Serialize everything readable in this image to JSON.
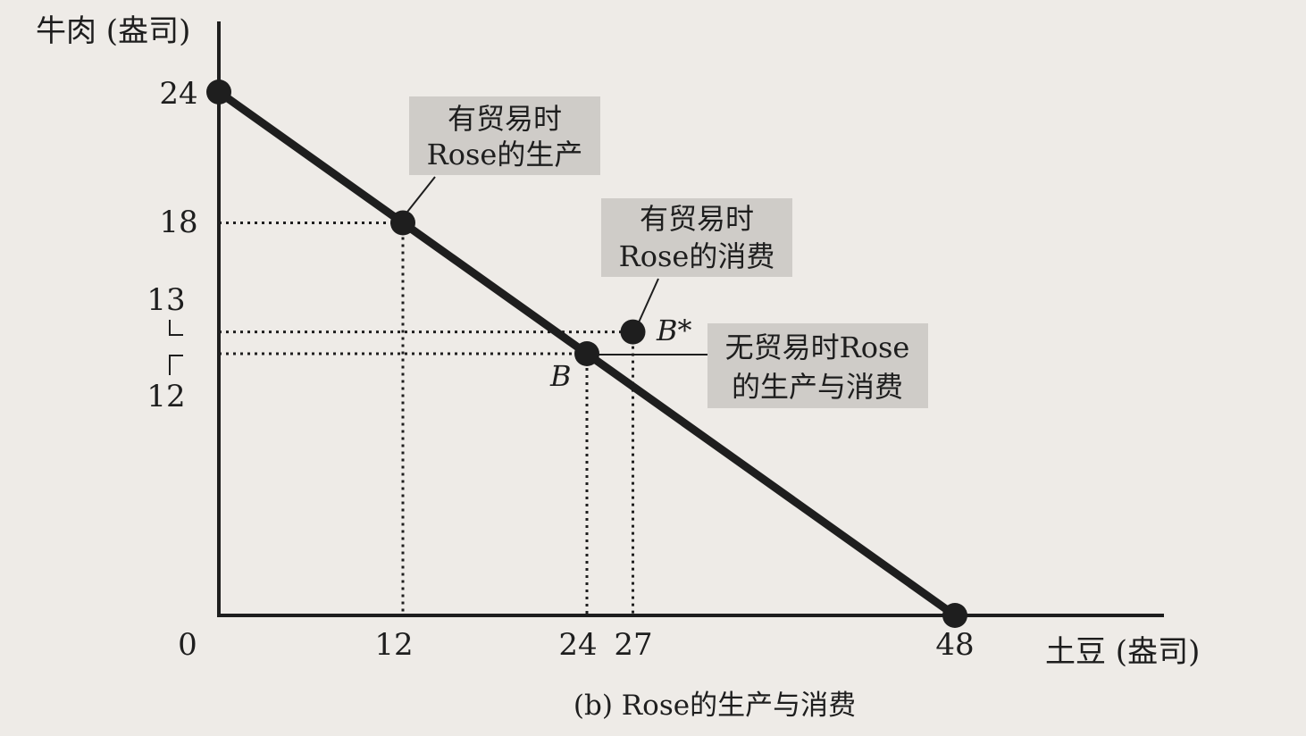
{
  "chart_data": {
    "type": "line",
    "title": "",
    "caption": "(b) Rose的生产与消费",
    "xlabel": "土豆 (盎司)",
    "ylabel": "牛肉 (盎司)",
    "xlim": [
      0,
      52
    ],
    "ylim": [
      0,
      27.5
    ],
    "origin_label": "0",
    "x_ticks": [
      {
        "value": 12,
        "label": "12"
      },
      {
        "value": 24,
        "label": "24"
      },
      {
        "value": 27,
        "label": "27"
      },
      {
        "value": 48,
        "label": "48"
      }
    ],
    "y_ticks": [
      {
        "value": 24,
        "label": "24"
      },
      {
        "value": 18,
        "label": "18"
      },
      {
        "value": 13,
        "label": "13"
      },
      {
        "value": 12,
        "label": "12"
      }
    ],
    "series": [
      {
        "name": "",
        "points": [
          {
            "x": 0,
            "y": 24
          },
          {
            "x": 48,
            "y": 0
          }
        ]
      }
    ],
    "points": [
      {
        "id": "endpoint-y",
        "x": 0,
        "y": 24,
        "label": ""
      },
      {
        "id": "production-with-trade",
        "x": 12,
        "y": 18,
        "label": ""
      },
      {
        "id": "point-B",
        "x": 24,
        "y": 12,
        "label": "B"
      },
      {
        "id": "point-B-star",
        "x": 27,
        "y": 13,
        "label": "B*"
      },
      {
        "id": "endpoint-x",
        "x": 48,
        "y": 0,
        "label": ""
      }
    ],
    "annotations": [
      {
        "id": "production-with-trade",
        "lines": [
          "有贸易时",
          "Rose的生产"
        ],
        "points_to": [
          12,
          18
        ]
      },
      {
        "id": "consumption-with-trade",
        "lines": [
          "有贸易时",
          "Rose的消费"
        ],
        "points_to": [
          27,
          13
        ]
      },
      {
        "id": "without-trade",
        "lines": [
          "无贸易时Rose",
          "的生产与消费"
        ],
        "points_to": [
          24,
          12
        ]
      }
    ],
    "grid": false,
    "colors": {
      "background": "#eeebe7",
      "ink": "#1e1e1e",
      "callout_fill": "#cfccc8"
    }
  }
}
